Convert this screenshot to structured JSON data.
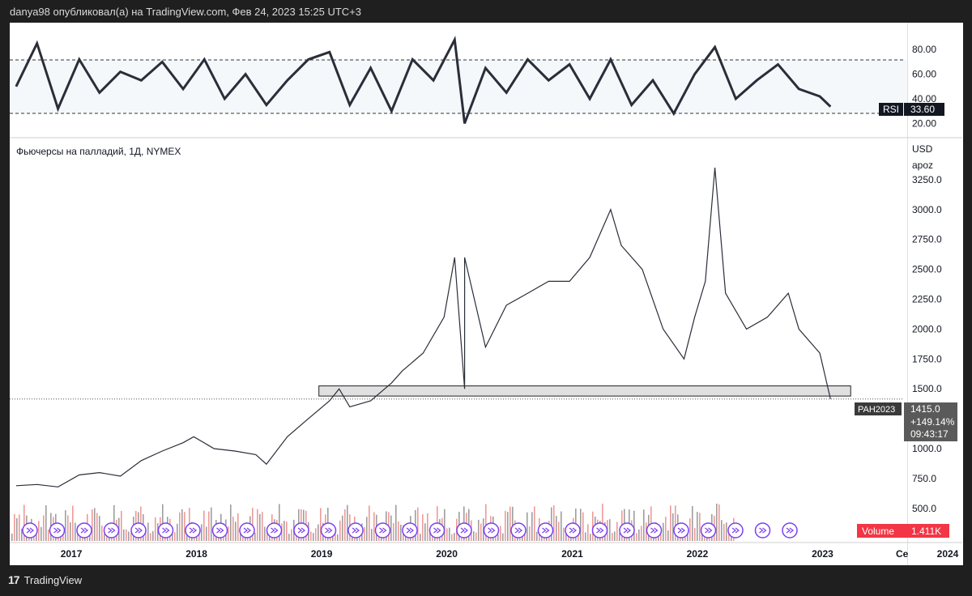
{
  "header": {
    "publisher": "danya98 опубликовал(а) на TradingView.com, Фев 24, 2023 15:25 UTC+3"
  },
  "footer": {
    "brand": "TradingView"
  },
  "chart_data": [
    {
      "type": "line",
      "title": "RSI",
      "indicator_label": "RSI",
      "last_value": "33.60",
      "ylim": [
        15,
        92
      ],
      "y_ticks": [
        "80.00",
        "60.00",
        "40.00",
        "20.00"
      ],
      "bands": [
        70,
        30
      ],
      "x": [
        "2016-08",
        "2016-10",
        "2016-12",
        "2017-02",
        "2017-04",
        "2017-06",
        "2017-08",
        "2017-10",
        "2017-12",
        "2018-02",
        "2018-04",
        "2018-06",
        "2018-08",
        "2018-10",
        "2018-12",
        "2019-02",
        "2019-04",
        "2019-06",
        "2019-08",
        "2019-10",
        "2019-12",
        "2020-02",
        "2020-03",
        "2020-05",
        "2020-07",
        "2020-09",
        "2020-11",
        "2021-01",
        "2021-03",
        "2021-05",
        "2021-07",
        "2021-09",
        "2021-11",
        "2022-01",
        "2022-03",
        "2022-05",
        "2022-07",
        "2022-09",
        "2022-11",
        "2023-01",
        "2023-02"
      ],
      "values": [
        50,
        85,
        32,
        72,
        45,
        62,
        55,
        70,
        48,
        72,
        40,
        60,
        35,
        55,
        72,
        78,
        35,
        65,
        30,
        72,
        55,
        88,
        20,
        65,
        45,
        72,
        55,
        68,
        40,
        72,
        35,
        55,
        28,
        60,
        82,
        40,
        55,
        68,
        48,
        42,
        33.6
      ]
    },
    {
      "type": "line",
      "title": "Фьючерсы на палладий, 1Д, NYMEX",
      "currency": "USD",
      "scale_label": "apoz",
      "ylim": [
        350,
        3500
      ],
      "y_ticks": [
        "3250.0",
        "3000.0",
        "2750.0",
        "2500.0",
        "2250.0",
        "2000.0",
        "1750.0",
        "1500.0",
        "1000.0",
        "750.0",
        "500.0"
      ],
      "x_ticks": [
        "2017",
        "2018",
        "2019",
        "2020",
        "2021",
        "2022",
        "2023",
        "2024",
        "Се"
      ],
      "x": [
        "2016-08",
        "2016-10",
        "2016-12",
        "2017-02",
        "2017-04",
        "2017-06",
        "2017-08",
        "2017-10",
        "2017-12",
        "2018-01",
        "2018-03",
        "2018-05",
        "2018-07",
        "2018-08",
        "2018-10",
        "2018-12",
        "2019-02",
        "2019-03",
        "2019-04",
        "2019-06",
        "2019-08",
        "2019-09",
        "2019-11",
        "2020-01",
        "2020-02",
        "2020-03",
        "2020-03",
        "2020-05",
        "2020-07",
        "2020-09",
        "2020-11",
        "2021-01",
        "2021-03",
        "2021-05",
        "2021-06",
        "2021-08",
        "2021-10",
        "2021-12",
        "2022-01",
        "2022-02",
        "2022-03",
        "2022-04",
        "2022-06",
        "2022-08",
        "2022-10",
        "2022-11",
        "2023-01",
        "2023-02"
      ],
      "values": [
        690,
        700,
        680,
        780,
        800,
        770,
        900,
        980,
        1050,
        1100,
        1000,
        980,
        950,
        870,
        1100,
        1250,
        1400,
        1500,
        1350,
        1400,
        1550,
        1650,
        1800,
        2100,
        2600,
        1500,
        2600,
        1850,
        2200,
        2300,
        2400,
        2400,
        2600,
        3000,
        2700,
        2500,
        2000,
        1750,
        2100,
        2400,
        3350,
        2300,
        2000,
        2100,
        2300,
        2000,
        1800,
        1415
      ],
      "last_price": "1415.0",
      "change": "+149.14%",
      "countdown": "09:43:17",
      "symbol": "PAH2023",
      "support_zone": {
        "from": 1440,
        "to": 1525,
        "start": "2019-01",
        "end": "2023-04"
      },
      "volume": {
        "label": "Volume",
        "value": "1.411K"
      }
    }
  ]
}
